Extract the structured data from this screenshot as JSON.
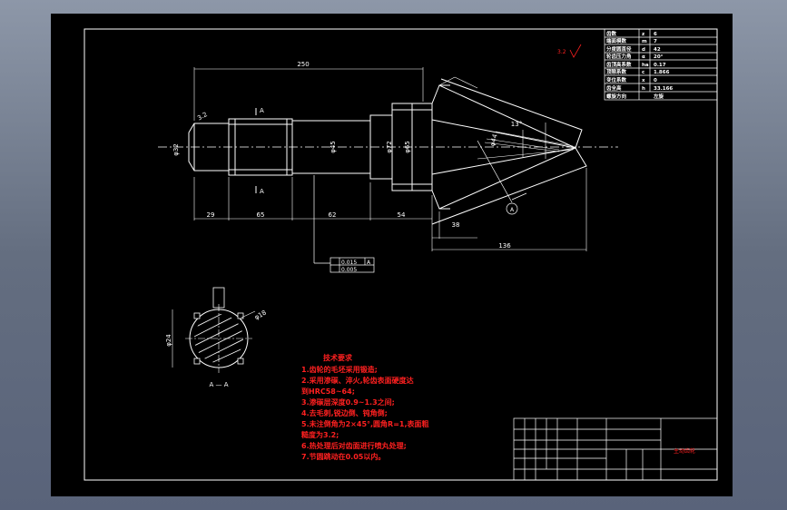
{
  "drawing": {
    "dimensions": {
      "overall_length": "250",
      "seg1": "29",
      "seg2": "65",
      "seg3": "62",
      "seg4": "54",
      "seg5": "38",
      "cone_length": "136",
      "dia_left": "φ32",
      "dia_mid": "φ45",
      "dia_big": "φ72",
      "dia_e": "φ65",
      "dia_f": "φ44",
      "angle": "13°",
      "ra": "3.2",
      "sec_dia": "φ18",
      "sec_dia2": "φ24"
    },
    "labels": {
      "section_mark_top": "A",
      "section_mark_bottom": "A",
      "section_view": "A — A",
      "callout": "A"
    },
    "tolerance": {
      "row1": "0.015",
      "row1_ref": "A",
      "row2": "0.005"
    },
    "tech_req": {
      "title": "技术要求",
      "lines": [
        "1.齿轮的毛坯采用锻造;",
        "2.采用渗碳、淬火,轮齿表面硬度达",
        "到HRC58~64;",
        "3.渗碳层深度0.9~1.3之间;",
        "4.去毛刺,锐边倒、钝角倒;",
        "5.未注倒角为2×45°,圆角R=1,表面粗",
        "糙度为3.2;",
        "6.热处理后对齿面进行喷丸处理;",
        "7.节圆跳动在0.05以内。"
      ]
    },
    "params": [
      [
        "齿数",
        "z",
        "6"
      ],
      [
        "端面模数",
        "m",
        "7"
      ],
      [
        "分度圆直径",
        "d",
        "42"
      ],
      [
        "轮齿压力角",
        "α",
        "20°"
      ],
      [
        "齿顶高系数",
        "ha",
        "0.17"
      ],
      [
        "顶隙系数",
        "c",
        "1.866"
      ],
      [
        "变位系数",
        "x",
        "0"
      ],
      [
        "齿全高",
        "h",
        "33.166"
      ],
      [
        "螺旋方向",
        "",
        "左旋"
      ]
    ],
    "title_block": {
      "part_name": "主动齿轮"
    }
  }
}
